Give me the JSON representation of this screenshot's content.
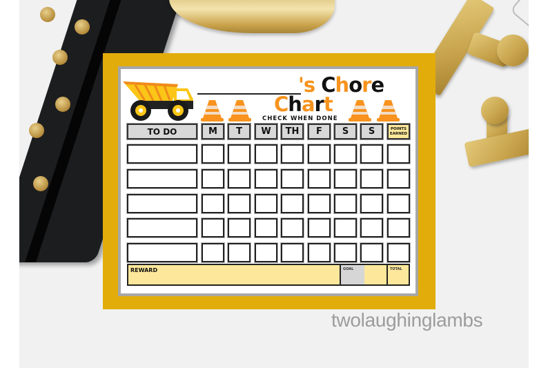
{
  "title": {
    "line1": [
      {
        "t": "'s ",
        "c": "orange"
      },
      {
        "t": "C",
        "c": "black"
      },
      {
        "t": "h",
        "c": "orange"
      },
      {
        "t": "o",
        "c": "black"
      },
      {
        "t": "r",
        "c": "orange"
      },
      {
        "t": "e",
        "c": "black"
      }
    ],
    "line2": [
      {
        "t": "C",
        "c": "orange"
      },
      {
        "t": "h",
        "c": "black"
      },
      {
        "t": "a",
        "c": "orange"
      },
      {
        "t": "r",
        "c": "black"
      },
      {
        "t": "t",
        "c": "orange"
      }
    ],
    "subtitle": "CHECK WHEN DONE"
  },
  "colors": {
    "frame": "#e2ad0a",
    "orange": "#f7931e",
    "truck_yellow": "#fbc617",
    "highlight_yellow": "#fde79a",
    "header_gray": "#d8d8d8"
  },
  "table": {
    "todo_header": "TO DO",
    "day_headers": [
      "M",
      "T",
      "W",
      "TH",
      "F",
      "S",
      "S"
    ],
    "points_header": [
      "POINTS",
      "EARNED"
    ],
    "rows": 5
  },
  "footer": {
    "reward_label": "REWARD",
    "goal_label": "GOAL",
    "total_label": "TOTAL"
  },
  "watermark": "twolaughinglambs",
  "icons": [
    "dump-truck-icon",
    "traffic-cone-icon"
  ]
}
